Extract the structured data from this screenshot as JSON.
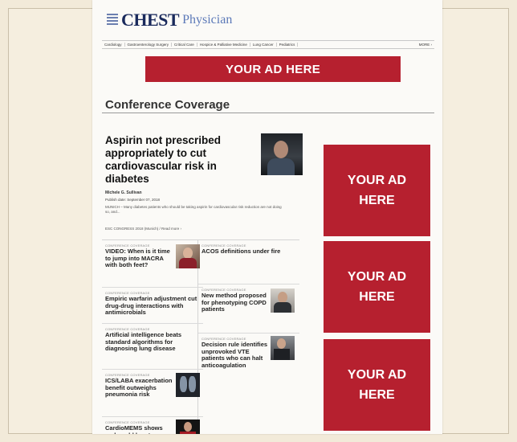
{
  "header": {
    "logo_main": "CHEST",
    "logo_sub": "Physician"
  },
  "nav": {
    "items": [
      "Cardiology",
      "Gastroenterology Surgery",
      "Critical Care",
      "Hospice & Palliative Medicine",
      "Lung Cancer",
      "Pediatrics"
    ],
    "more_label": "MORE ›"
  },
  "ads": {
    "top": "YOUR AD HERE",
    "side_line1": "YOUR AD",
    "side_line2": "HERE"
  },
  "section": {
    "title": "Conference Coverage"
  },
  "featured": {
    "title": "Aspirin not prescribed appropriately to cut cardiovascular risk in diabetes",
    "byline": "Michele G. Sullivan",
    "pubdate": "Publish date: September 07, 2018",
    "summary": "MUNICH – Many diabetes patients who should be taking aspirin for cardiovascular risk reduction are not doing so, and...",
    "read_more": "ESC CONGRESS 2018 (Munich) / Read more ›"
  },
  "articles": {
    "a1": {
      "tag": "CONFERENCE COVERAGE",
      "title": "VIDEO: When is it time to jump into MACRA with both feet?"
    },
    "a2": {
      "tag": "CONFERENCE COVERAGE",
      "title": "ACOS definitions under fire"
    },
    "a3": {
      "tag": "CONFERENCE COVERAGE",
      "title": "Empiric warfarin adjustment cut drug-drug interactions with antimicrobials"
    },
    "a4": {
      "tag": "CONFERENCE COVERAGE",
      "title": "New method proposed for phenotyping COPD patients"
    },
    "a5": {
      "tag": "CONFERENCE COVERAGE",
      "title": "Artificial intelligence beats standard algorithms for diagnosing lung disease"
    },
    "a6": {
      "tag": "CONFERENCE COVERAGE",
      "title": "Decision rule identifies unprovoked VTE patients who can halt anticoagulation"
    },
    "a7": {
      "tag": "CONFERENCE COVERAGE",
      "title": "ICS/LABA exacerbation benefit outweighs pneumonia risk"
    },
    "a8": {
      "tag": "CONFERENCE COVERAGE",
      "title": "CardioMEMS shows real-world heart"
    }
  },
  "colors": {
    "ad_red": "#b6202f",
    "logo_navy": "#1a2a5c",
    "logo_blue": "#5c79b8"
  }
}
